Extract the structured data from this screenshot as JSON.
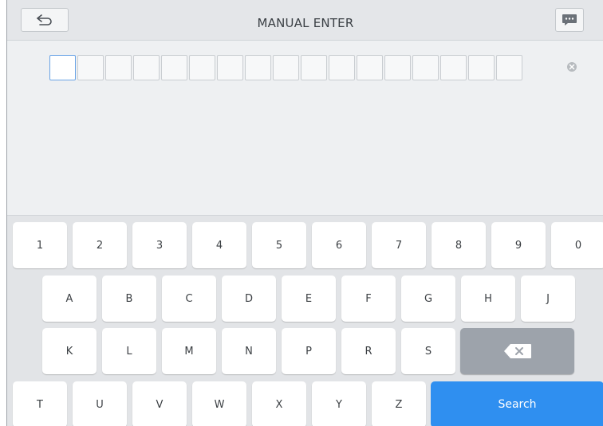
{
  "header": {
    "title": "MANUAL ENTER",
    "back_icon": "back-arrow-icon",
    "message_icon": "chat-bubble-icon"
  },
  "input": {
    "cell_count": 17,
    "active_index": 0,
    "clear_icon": "clear-circle-icon"
  },
  "keyboard": {
    "row1": [
      "1",
      "2",
      "3",
      "4",
      "5",
      "6",
      "7",
      "8",
      "9",
      "0"
    ],
    "row2": [
      "A",
      "B",
      "C",
      "D",
      "E",
      "F",
      "G",
      "H",
      "J"
    ],
    "row3": [
      "K",
      "L",
      "M",
      "N",
      "P",
      "R",
      "S"
    ],
    "row4": [
      "T",
      "U",
      "V",
      "W",
      "X",
      "Y",
      "Z"
    ],
    "backspace_icon": "backspace-icon",
    "search_label": "Search"
  },
  "colors": {
    "accent": "#2f8ff0",
    "backspace_key": "#9da3ab",
    "background": "#eef0f2"
  }
}
